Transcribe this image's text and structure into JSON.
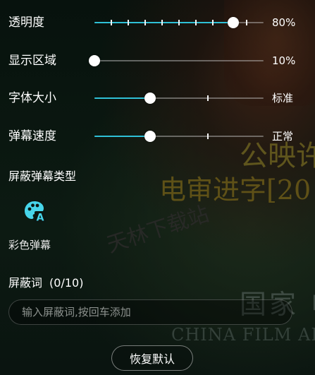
{
  "background": {
    "text_1": "公映许",
    "text_2": "电审进字[20",
    "text_stamp": "天林下载站",
    "text_3": "国家 电",
    "text_4": "CHINA FILM AD"
  },
  "colors": {
    "accent": "#2fc0d6",
    "track": "#8a8a8a",
    "thumb": "#ffffff"
  },
  "sliders": [
    {
      "label": "透明度",
      "value": "80%",
      "level": 0.82,
      "ticks": [
        0.1,
        0.2,
        0.3,
        0.4,
        0.5,
        0.6,
        0.7,
        0.9
      ]
    },
    {
      "label": "显示区域",
      "value": "10%",
      "level": 0.0,
      "ticks": []
    },
    {
      "label": "字体大小",
      "value": "标准",
      "level": 0.33,
      "ticks": [
        0.67
      ]
    },
    {
      "label": "弹幕速度",
      "value": "正常",
      "level": 0.33,
      "ticks": [
        0.67
      ]
    }
  ],
  "block_types": {
    "title": "屏蔽弹幕类型",
    "items": [
      {
        "label": "彩色弹幕",
        "icon": "palette-icon"
      }
    ]
  },
  "block_words": {
    "title": "屏蔽词",
    "count": "(0/10)",
    "placeholder": "输入屏蔽词,按回车添加"
  },
  "reset_button": {
    "label": "恢复默认"
  }
}
